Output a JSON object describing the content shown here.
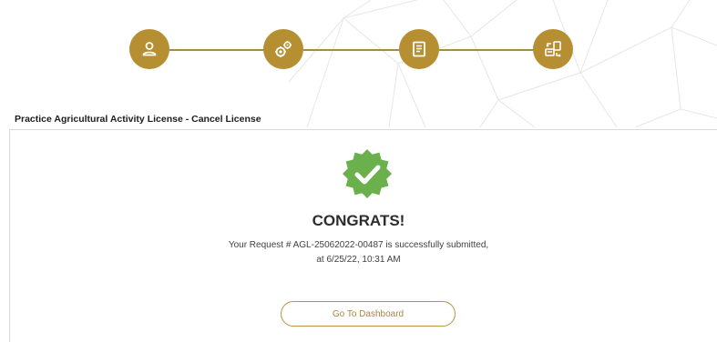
{
  "stepper": {
    "steps": [
      {
        "icon": "user-icon"
      },
      {
        "icon": "gears-icon"
      },
      {
        "icon": "document-icon"
      },
      {
        "icon": "documents-exchange-icon"
      }
    ],
    "color": "#b58f31"
  },
  "page": {
    "heading": "Practice Agricultural Activity License - Cancel License"
  },
  "success": {
    "icon": "checkmark-badge-icon",
    "badge_color": "#6ab04c",
    "title": "CONGRATS!",
    "message_line1": "Your Request # AGL-25062022-00487 is successfully submitted,",
    "message_line2": "at 6/25/22, 10:31 AM"
  },
  "actions": {
    "dashboard_label": "Go To Dashboard",
    "accent": "#b59445"
  }
}
